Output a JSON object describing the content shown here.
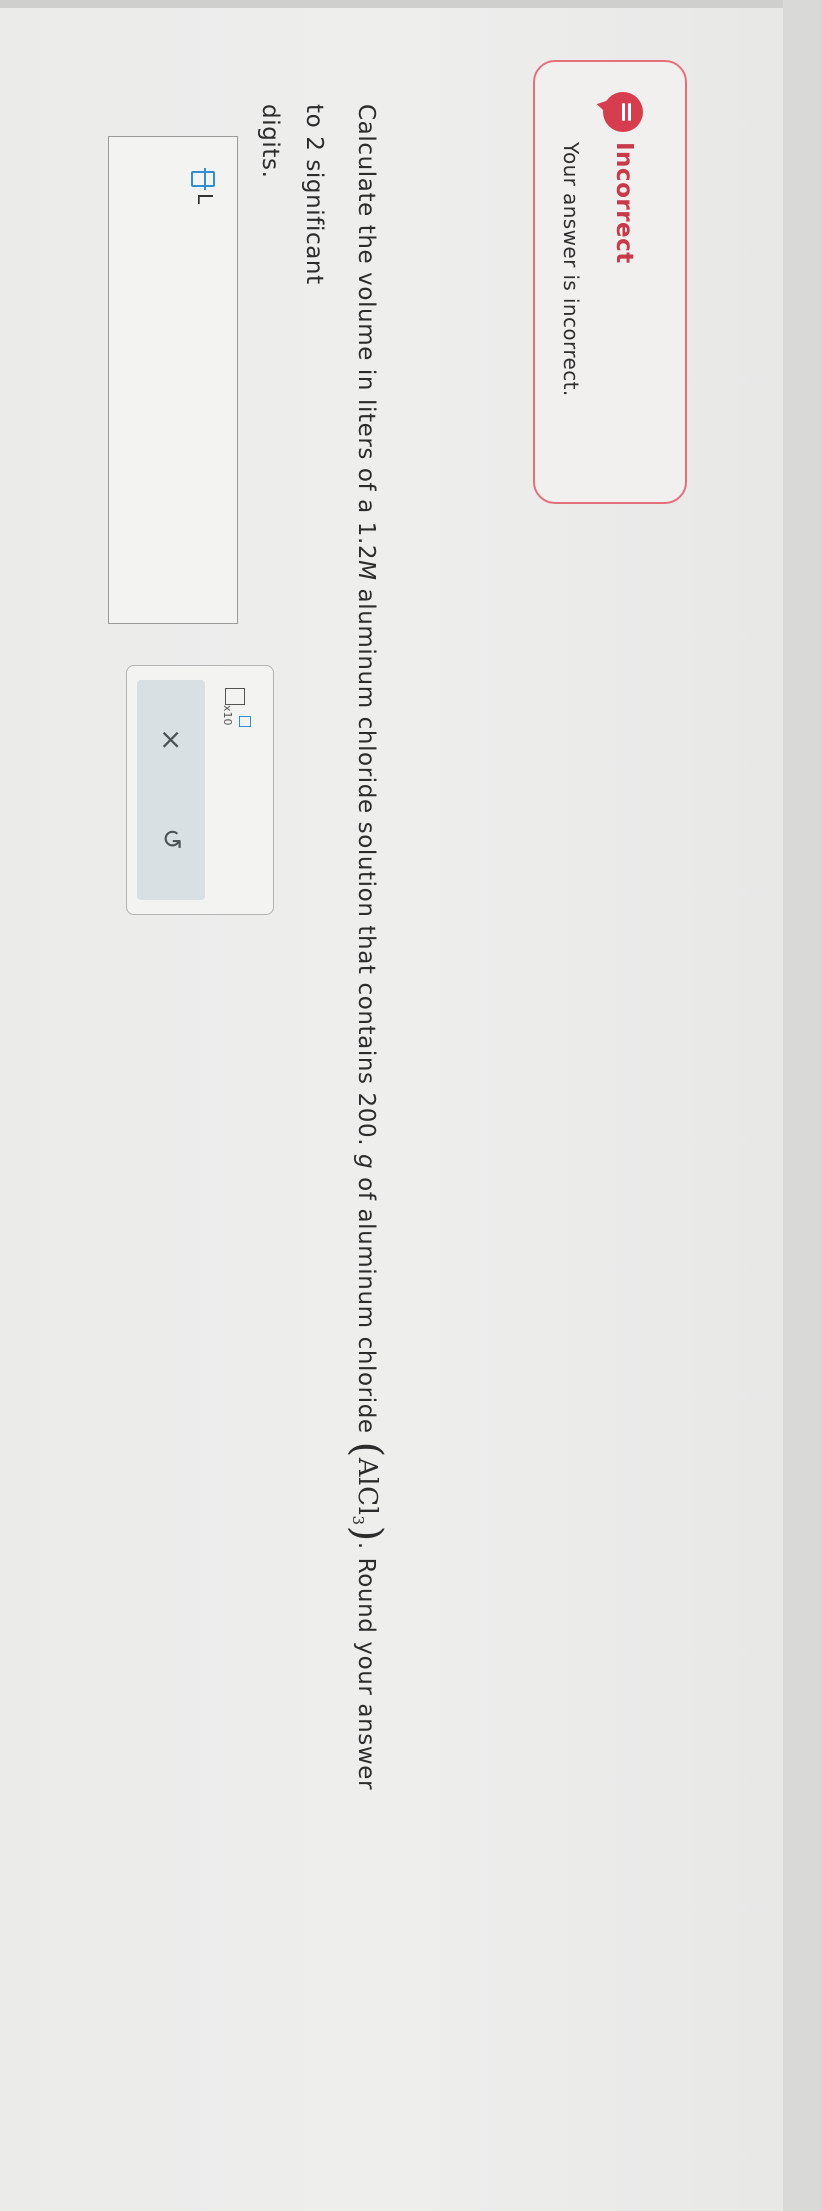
{
  "feedback": {
    "title": "Incorrect",
    "message": "Your answer is incorrect.",
    "icon": "chat-bubble-icon",
    "color": "#d63d4e"
  },
  "question": {
    "part1": "Calculate the volume in liters of a 1.2",
    "molarity_unit": "M",
    "part2": " aluminum chloride solution that contains 200. ",
    "mass_unit": "g",
    "part3": " of aluminum chloride ",
    "formula_open": "(",
    "formula_main": "AlCl",
    "formula_sub": "3",
    "formula_close": ")",
    "part4": ". Round your answer to 2 significant",
    "line2": "digits."
  },
  "answer": {
    "value": "",
    "unit": "L"
  },
  "palette": {
    "x10_label": "x10",
    "clear_symbol": "×",
    "undo_symbol": "↺"
  }
}
